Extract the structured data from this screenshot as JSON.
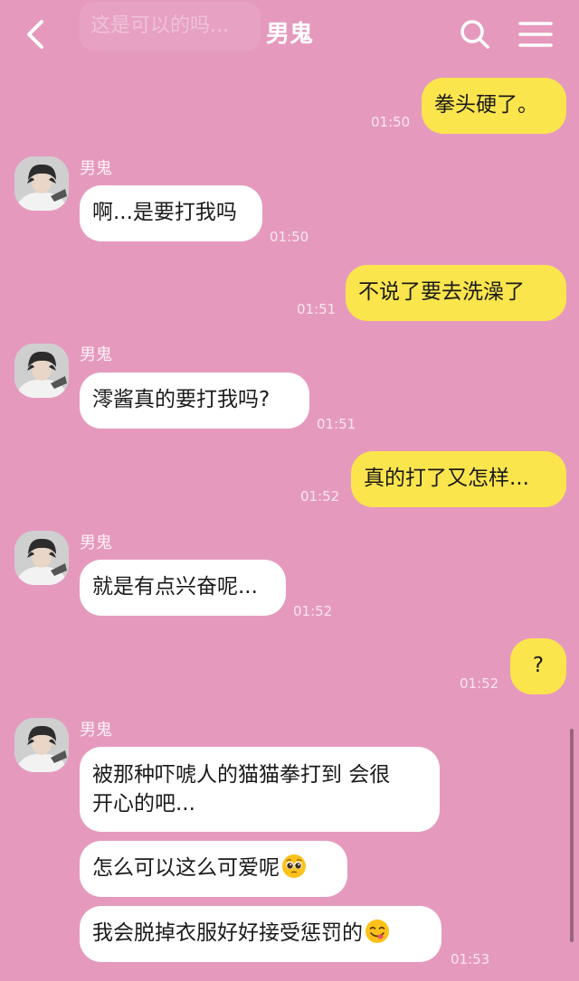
{
  "header": {
    "title": "男鬼",
    "preview_text": "这是可以的吗..."
  },
  "contact": {
    "name": "男鬼"
  },
  "messages": [
    {
      "text": "拳头硬了。",
      "time": "01:50"
    },
    {
      "text": "啊...是要打我吗",
      "time": "01:50"
    },
    {
      "text": "不说了要去洗澡了",
      "time": "01:51"
    },
    {
      "text": "澪酱真的要打我吗?",
      "time": "01:51"
    },
    {
      "text": "真的打了又怎样...",
      "time": "01:52"
    },
    {
      "text": "就是有点兴奋呢...",
      "time": "01:52"
    },
    {
      "text": "?",
      "time": "01:52"
    },
    {
      "text_line1": "被那种吓唬人的猫猫拳打到 会很",
      "text_line2": "开心的吧..."
    },
    {
      "text": "怎么可以这么可爱呢"
    },
    {
      "text": "我会脱掉衣服好好接受惩罚的",
      "time": "01:53"
    }
  ],
  "colors": {
    "background": "#e59abd",
    "outgoing_bubble": "#fbe54d",
    "incoming_bubble": "#ffffff"
  },
  "icons": {
    "back": "chevron-left-icon",
    "search": "search-icon",
    "menu": "hamburger-menu-icon",
    "emoji_pleading": "pleading-face-emoji",
    "emoji_yum": "face-savoring-food-emoji"
  }
}
